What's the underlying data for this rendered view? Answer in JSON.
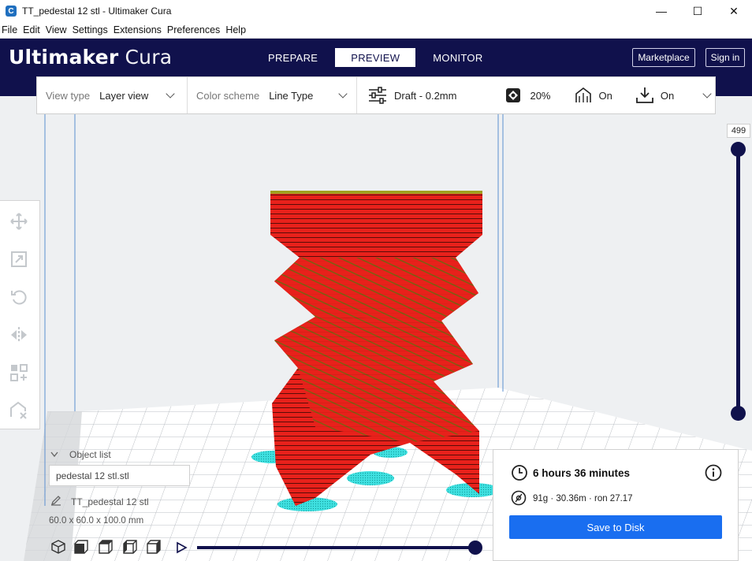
{
  "window": {
    "title": "TT_pedestal 12 stl - Ultimaker Cura",
    "app_icon_letter": "C",
    "minimize": "—",
    "maximize": "☐",
    "close": "✕"
  },
  "menu": [
    "File",
    "Edit",
    "View",
    "Settings",
    "Extensions",
    "Preferences",
    "Help"
  ],
  "header": {
    "logo_brand": "Ultimaker",
    "logo_product": "Cura",
    "tabs": [
      {
        "label": "PREPARE",
        "active": false
      },
      {
        "label": "PREVIEW",
        "active": true
      },
      {
        "label": "MONITOR",
        "active": false
      }
    ],
    "marketplace": "Marketplace",
    "signin": "Sign in"
  },
  "toolbar": {
    "view_type_label": "View type",
    "view_type_value": "Layer view",
    "color_scheme_label": "Color scheme",
    "color_scheme_value": "Line Type",
    "profile": "Draft - 0.2mm",
    "infill": "20%",
    "support": "On",
    "adhesion": "On"
  },
  "layer_slider": {
    "value": "499"
  },
  "object_list": {
    "title": "Object list",
    "field_value": "pedestal 12 stl.stl",
    "object_name": "TT_pedestal 12 stl",
    "dimensions": "60.0 x 60.0 x 100.0 mm"
  },
  "print_panel": {
    "time": "6 hours 36 minutes",
    "material": "91g · 30.36m · ron 27.17",
    "save_button": "Save to Disk"
  },
  "colors": {
    "header_bg": "#10114c",
    "accent": "#196ef0",
    "model_red": "#e8211b",
    "support_cyan": "#2fdcdc"
  }
}
